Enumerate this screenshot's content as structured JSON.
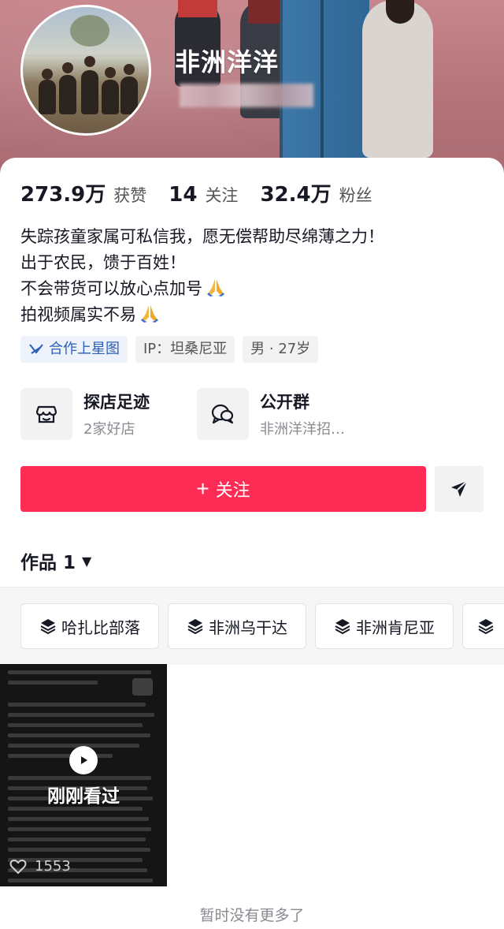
{
  "profile": {
    "username": "非洲洋洋",
    "stats": [
      {
        "value": "273.9万",
        "label": "获赞"
      },
      {
        "value": "14",
        "label": "关注"
      },
      {
        "value": "32.4万",
        "label": "粉丝"
      }
    ],
    "bio": [
      "失踪孩童家属可私信我，愿无偿帮助尽绵薄之力！",
      "出于农民，馈于百姓！",
      "不会带货可以放心点加号",
      "拍视频属实不易"
    ],
    "tags": {
      "cooperation": "合作上星图",
      "ip": "IP：坦桑尼亚",
      "gender_age": "男 · 27岁"
    },
    "shortcuts": [
      {
        "title": "探店足迹",
        "subtitle": "2家好店",
        "icon": "store-icon"
      },
      {
        "title": "公开群",
        "subtitle": "非洲洋洋招…",
        "icon": "chat-bubbles-icon"
      }
    ],
    "follow_label": "关注",
    "share_icon": "send-arrow-icon",
    "accent_color": "#fe2c55"
  },
  "works": {
    "title": "作品 1",
    "collections": [
      "哈扎比部落",
      "非洲乌干达",
      "非洲肯尼亚"
    ],
    "videos": [
      {
        "overlay_label": "刚刚看过",
        "likes": "1553"
      }
    ],
    "footer": "暂时没有更多了"
  }
}
